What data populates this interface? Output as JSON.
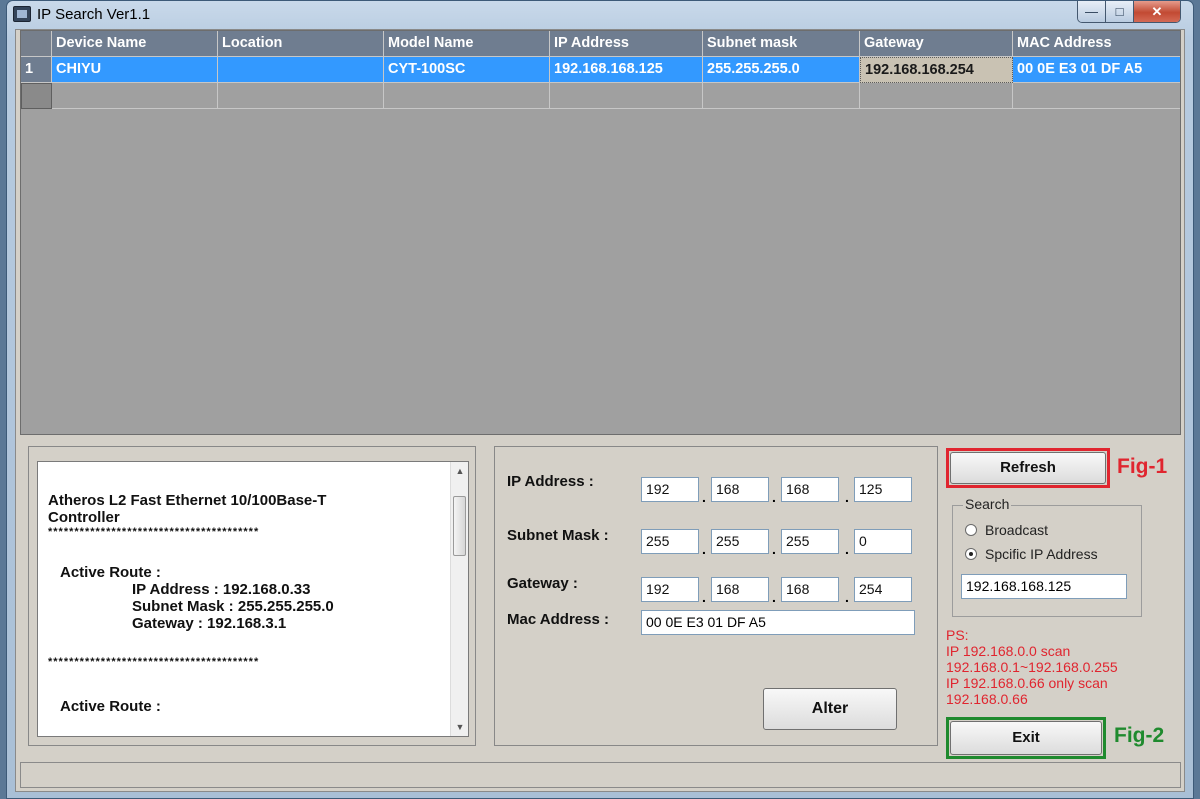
{
  "window": {
    "title": "IP Search Ver1.1"
  },
  "grid": {
    "columns": [
      "Device Name",
      "Location",
      "Model Name",
      "IP Address",
      "Subnet mask",
      "Gateway",
      "MAC Address"
    ],
    "rows": [
      {
        "num": "1",
        "cells": [
          "CHIYU",
          "",
          "CYT-100SC",
          "192.168.168.125",
          "255.255.255.0",
          "192.168.168.254",
          "00 0E E3 01 DF A5"
        ]
      }
    ]
  },
  "info": {
    "lines": [
      "Atheros L2 Fast Ethernet 10/100Base-T",
      "Controller",
      "****************************************",
      "",
      "Active Route :",
      "IP Address : 192.168.0.33",
      "Subnet Mask : 255.255.255.0",
      "Gateway : 192.168.3.1",
      "",
      "****************************************",
      "",
      "Active Route :"
    ]
  },
  "ip_form": {
    "ip_label": "IP Address :",
    "ip": [
      "192",
      "168",
      "168",
      "125"
    ],
    "mask_label": "Subnet Mask :",
    "mask": [
      "255",
      "255",
      "255",
      "0"
    ],
    "gateway_label": "Gateway :",
    "gateway": [
      "192",
      "168",
      "168",
      "254"
    ],
    "mac_label": "Mac Address :",
    "mac": "00 0E E3 01 DF A5",
    "alter_label": "Alter"
  },
  "controls": {
    "refresh_label": "Refresh",
    "fig1": "Fig-1",
    "search_legend": "Search",
    "broadcast_label": "Broadcast",
    "specific_label": "Spcific IP Address",
    "search_ip": "192.168.168.125",
    "exit_label": "Exit",
    "fig2": "Fig-2",
    "ps_lines": [
      "PS:",
      "IP 192.168.0.0 scan",
      "192.168.0.1~192.168.0.255",
      "IP 192.168.0.66 only scan",
      "192.168.0.66"
    ]
  },
  "colors": {
    "selection": "#3399ff",
    "header": "#6f7d90",
    "annotation_red": "#e0252f",
    "annotation_green": "#1f8a2e"
  }
}
